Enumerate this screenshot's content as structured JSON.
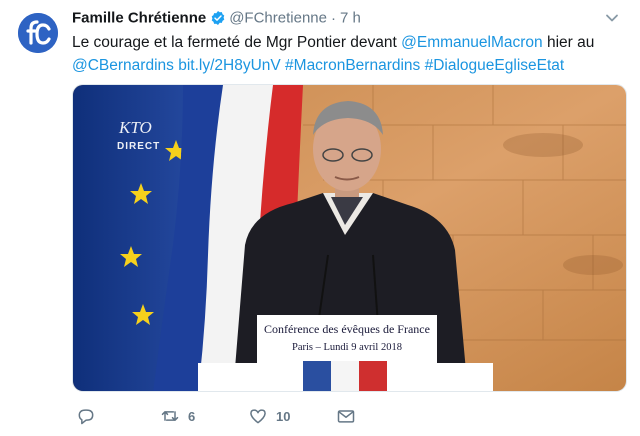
{
  "author": {
    "name": "Famille Chrétienne",
    "handle": "@FChretienne",
    "separator": "·",
    "time": "7 h"
  },
  "tweet": {
    "parts": [
      {
        "text": "Le courage et la fermeté de Mgr Pontier devant ",
        "link": false
      },
      {
        "text": "@EmmanuelMacron",
        "link": true
      },
      {
        "text": " hier au ",
        "link": false
      },
      {
        "text": "@CBernardins",
        "link": true
      },
      {
        "text": " ",
        "link": false
      },
      {
        "text": "bit.ly/2H8yUnV",
        "link": true
      },
      {
        "text": " ",
        "link": false
      },
      {
        "text": "#MacronBernardins",
        "link": true
      },
      {
        "text": " ",
        "link": false
      },
      {
        "text": "#DialogueEgliseEtat",
        "link": true
      }
    ]
  },
  "media": {
    "logo_text": "KTO",
    "live_text": "DIRECT",
    "sign_title": "Conférence des évêques de France",
    "sign_subtitle": "Paris – Lundi 9 avril 2018"
  },
  "actions": {
    "retweet_count": "6",
    "like_count": "10"
  },
  "colors": {
    "link": "#1b95e0",
    "muted": "#657786",
    "verified": "#1da1f2",
    "avatar": "#2e63c3"
  }
}
